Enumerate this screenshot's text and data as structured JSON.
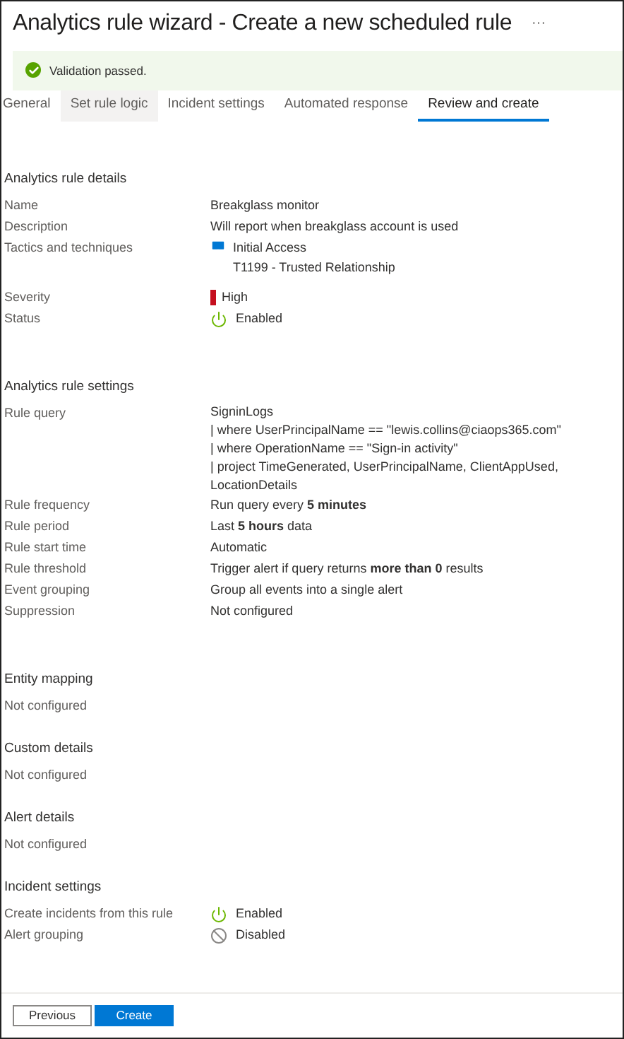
{
  "title": "Analytics rule wizard - Create a new scheduled rule",
  "more_button": "···",
  "banner": {
    "text": "Validation passed."
  },
  "tabs": [
    {
      "label": "General",
      "selected": false,
      "highlighted": false
    },
    {
      "label": "Set rule logic",
      "selected": false,
      "highlighted": true
    },
    {
      "label": "Incident settings",
      "selected": false,
      "highlighted": false
    },
    {
      "label": "Automated response",
      "selected": false,
      "highlighted": false
    },
    {
      "label": "Review and create",
      "selected": true,
      "highlighted": false
    }
  ],
  "sections": [
    {
      "kind": "table",
      "title": "Analytics rule details",
      "rows": [
        {
          "label": "Name",
          "kind": "text",
          "value": "Breakglass monitor"
        },
        {
          "label": "Description",
          "kind": "text",
          "value": "Will report when breakglass account is used"
        },
        {
          "label": "Tactics and techniques",
          "kind": "tactic",
          "value": "Initial Access",
          "detail": "T1199 - Trusted Relationship"
        },
        {
          "label": "Severity",
          "kind": "severity",
          "value": "High",
          "color": "#c50f1f"
        },
        {
          "label": "Status",
          "kind": "status",
          "value": "Enabled",
          "enabled": true
        }
      ]
    },
    {
      "kind": "table",
      "title": "Analytics rule settings",
      "rows": [
        {
          "label": "Rule query",
          "kind": "lines",
          "lines": [
            "SigninLogs",
            "| where UserPrincipalName == \"lewis.collins@ciaops365.com\"",
            "| where OperationName == \"Sign-in activity\"",
            "| project TimeGenerated, UserPrincipalName, ClientAppUsed, LocationDetails"
          ]
        },
        {
          "label": "Rule frequency",
          "kind": "text",
          "value": "Run query every **5 minutes**"
        },
        {
          "label": "Rule period",
          "kind": "text",
          "value": "Last **5 hours** data"
        },
        {
          "label": "Rule start time",
          "kind": "text",
          "value": "Automatic"
        },
        {
          "label": "Rule threshold",
          "kind": "text",
          "value": "Trigger alert if query returns **more than 0** results"
        },
        {
          "label": "Event grouping",
          "kind": "text",
          "value": "Group all events into a single alert"
        },
        {
          "label": "Suppression",
          "kind": "text",
          "value": "Not configured"
        }
      ]
    },
    {
      "kind": "note",
      "title": "Entity mapping",
      "text": "Not configured"
    },
    {
      "kind": "note",
      "title": "Custom details",
      "text": "Not configured"
    },
    {
      "kind": "note",
      "title": "Alert details",
      "text": "Not configured"
    },
    {
      "kind": "table",
      "title": "Incident settings",
      "rows": [
        {
          "label": "Create incidents from this rule",
          "kind": "status",
          "value": "Enabled",
          "enabled": true
        },
        {
          "label": "Alert grouping",
          "kind": "status",
          "value": "Disabled",
          "enabled": false
        }
      ]
    }
  ],
  "footer": {
    "buttons": [
      {
        "label": "Previous",
        "primary": false
      },
      {
        "label": "Create",
        "primary": true
      }
    ]
  }
}
